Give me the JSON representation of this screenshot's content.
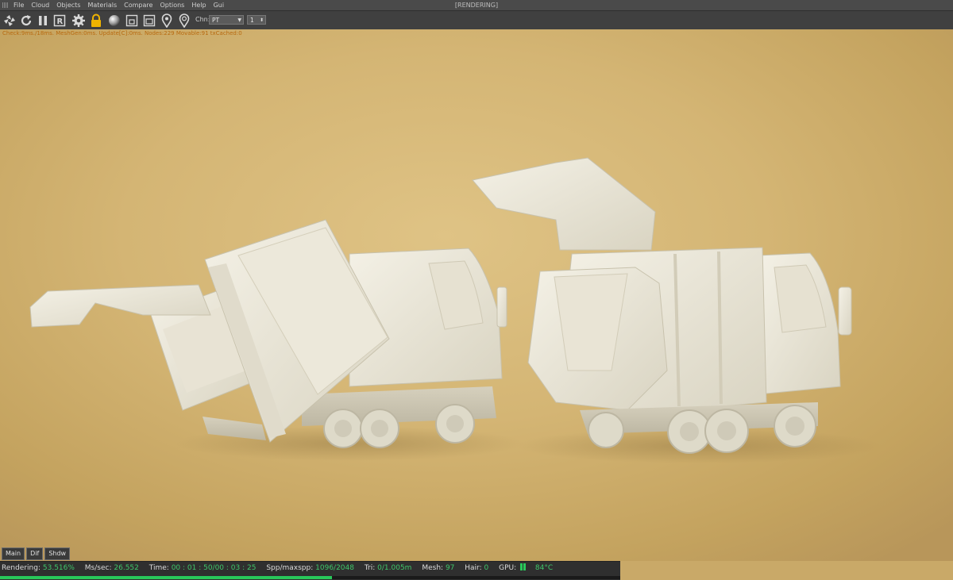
{
  "menu": {
    "items": [
      "File",
      "Cloud",
      "Objects",
      "Materials",
      "Compare",
      "Options",
      "Help",
      "Gui"
    ],
    "window_title": "[RENDERING]"
  },
  "toolbar": {
    "icons": [
      "aperture-icon",
      "refresh-icon",
      "pause-icon",
      "region-render-icon",
      "settings-gear-icon",
      "lock-icon",
      "sphere-icon",
      "clay-mode-icon",
      "sub-clay-icon",
      "pin-icon",
      "pin-pick-icon"
    ],
    "channel_label": "Chn:",
    "channel_value": "PT",
    "channel_count": "1",
    "lock_color": "#f0b400"
  },
  "viewport": {
    "stats": "Check:9ms./18ms. MeshGen:0ms. Update[C]:0ms. Nodes:229 Movable:91 txCached:0",
    "background_color": "#d4b574"
  },
  "tabs": [
    "Main",
    "Dif",
    "Shdw"
  ],
  "status": {
    "rendering_label": "Rendering:",
    "rendering_value": "53.516%",
    "mssec_label": "Ms/sec:",
    "mssec_value": "26.552",
    "time_label": "Time:",
    "time_value": "00 : 01 : 50/00 : 03 : 25",
    "spp_label": "Spp/maxspp:",
    "spp_value": "1096/2048",
    "tri_label": "Tri:",
    "tri_value": "0/1.005m",
    "mesh_label": "Mesh:",
    "mesh_value": "97",
    "hair_label": "Hair:",
    "hair_value": "0",
    "gpu_label": "GPU:",
    "gpu_temp": "84°C",
    "progress_fraction": 0.53516,
    "accent": "#28c85a"
  }
}
